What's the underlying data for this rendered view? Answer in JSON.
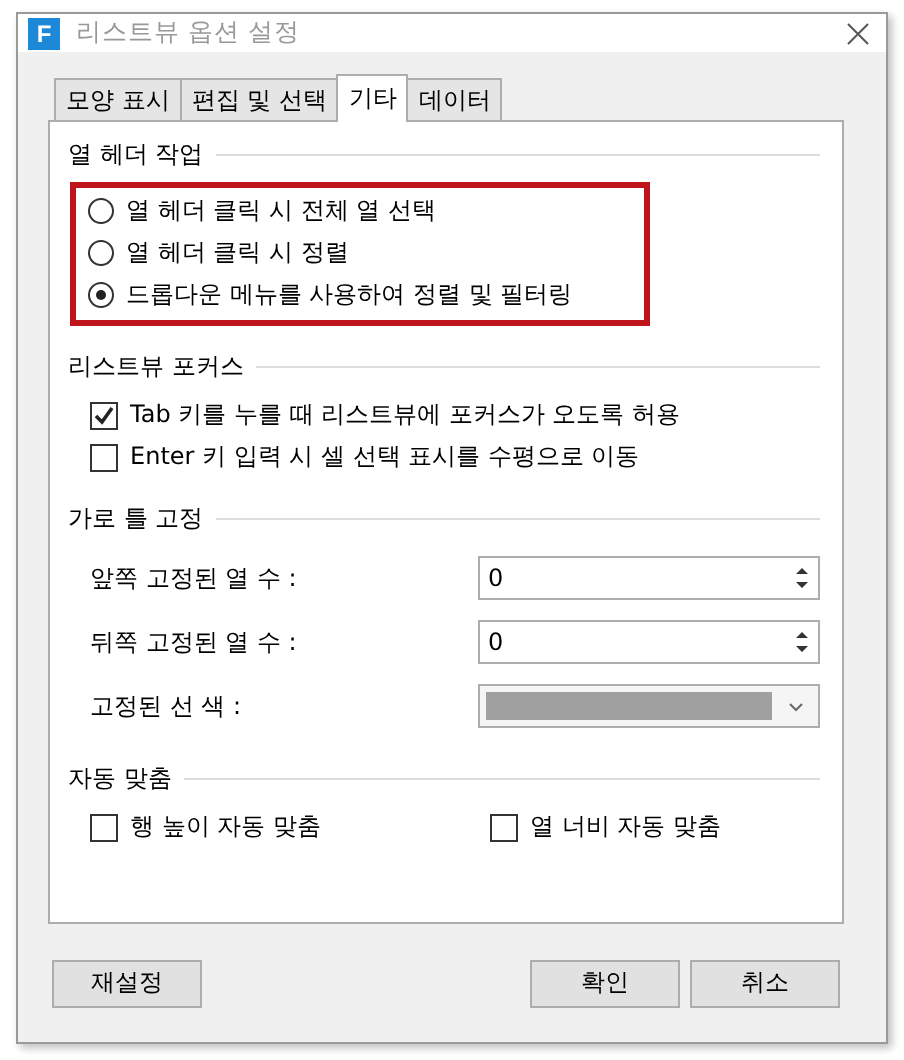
{
  "window": {
    "title": "리스트뷰 옵션 설정",
    "app_icon": "F"
  },
  "tabs": [
    {
      "label": "모양 표시",
      "selected": false
    },
    {
      "label": "편집 및 선택",
      "selected": false
    },
    {
      "label": "기타",
      "selected": true
    },
    {
      "label": "데이터",
      "selected": false
    }
  ],
  "sections": [
    {
      "title": "열 헤더 작업",
      "highlighted": true,
      "kind": "list",
      "items": [
        {
          "kind": "radio",
          "label": "열 헤더 클릭 시 전체 열 선택",
          "selected": false
        },
        {
          "kind": "radio",
          "label": "열 헤더 클릭 시 정렬",
          "selected": false
        },
        {
          "kind": "radio",
          "label": "드롭다운 메뉴를 사용하여 정렬 및 필터링",
          "selected": true
        }
      ]
    },
    {
      "title": "리스트뷰 포커스",
      "highlighted": false,
      "kind": "list",
      "items": [
        {
          "kind": "checkbox",
          "label": "Tab 키를 누를 때 리스트뷰에 포커스가 오도록 허용",
          "checked": true
        },
        {
          "kind": "checkbox",
          "label": "Enter 키 입력 시 셀 선택 표시를 수평으로 이동",
          "checked": false
        }
      ]
    },
    {
      "title": "가로 틀 고정",
      "highlighted": false,
      "kind": "list",
      "items": [
        {
          "kind": "spin",
          "label": "앞쪽 고정된 열 수 :",
          "value": "0"
        },
        {
          "kind": "spin",
          "label": "뒤쪽 고정된 열 수 :",
          "value": "0"
        },
        {
          "kind": "color",
          "label": "고정된 선 색 :"
        }
      ]
    },
    {
      "title": "자동 맞춤",
      "highlighted": false,
      "kind": "row",
      "items": [
        {
          "kind": "checkbox",
          "label": "행 높이 자동 맞춤",
          "checked": false
        },
        {
          "kind": "checkbox",
          "label": "열 너비 자동 맞춤",
          "checked": false
        }
      ]
    }
  ],
  "buttons": [
    {
      "label": "재설정",
      "kind": "left"
    },
    {
      "label": "확인",
      "kind": "right"
    },
    {
      "label": "취소",
      "kind": "right"
    }
  ]
}
